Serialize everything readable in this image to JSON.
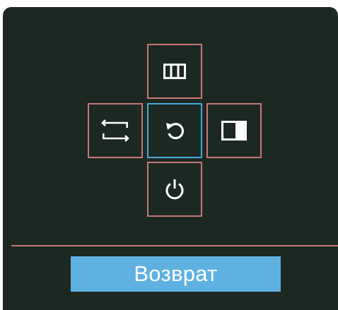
{
  "menu": {
    "up": {
      "icon": "columns-icon"
    },
    "left": {
      "icon": "input-switch-icon"
    },
    "center": {
      "icon": "return-icon",
      "selected": true
    },
    "right": {
      "icon": "picture-mode-icon"
    },
    "down": {
      "icon": "power-icon"
    }
  },
  "selected_label": "Возврат",
  "colors": {
    "background": "#1c2822",
    "button_border": "#c97676",
    "selected_border": "#45a9dc",
    "label_bar": "#5fb1e2",
    "icon": "#ffffff"
  }
}
